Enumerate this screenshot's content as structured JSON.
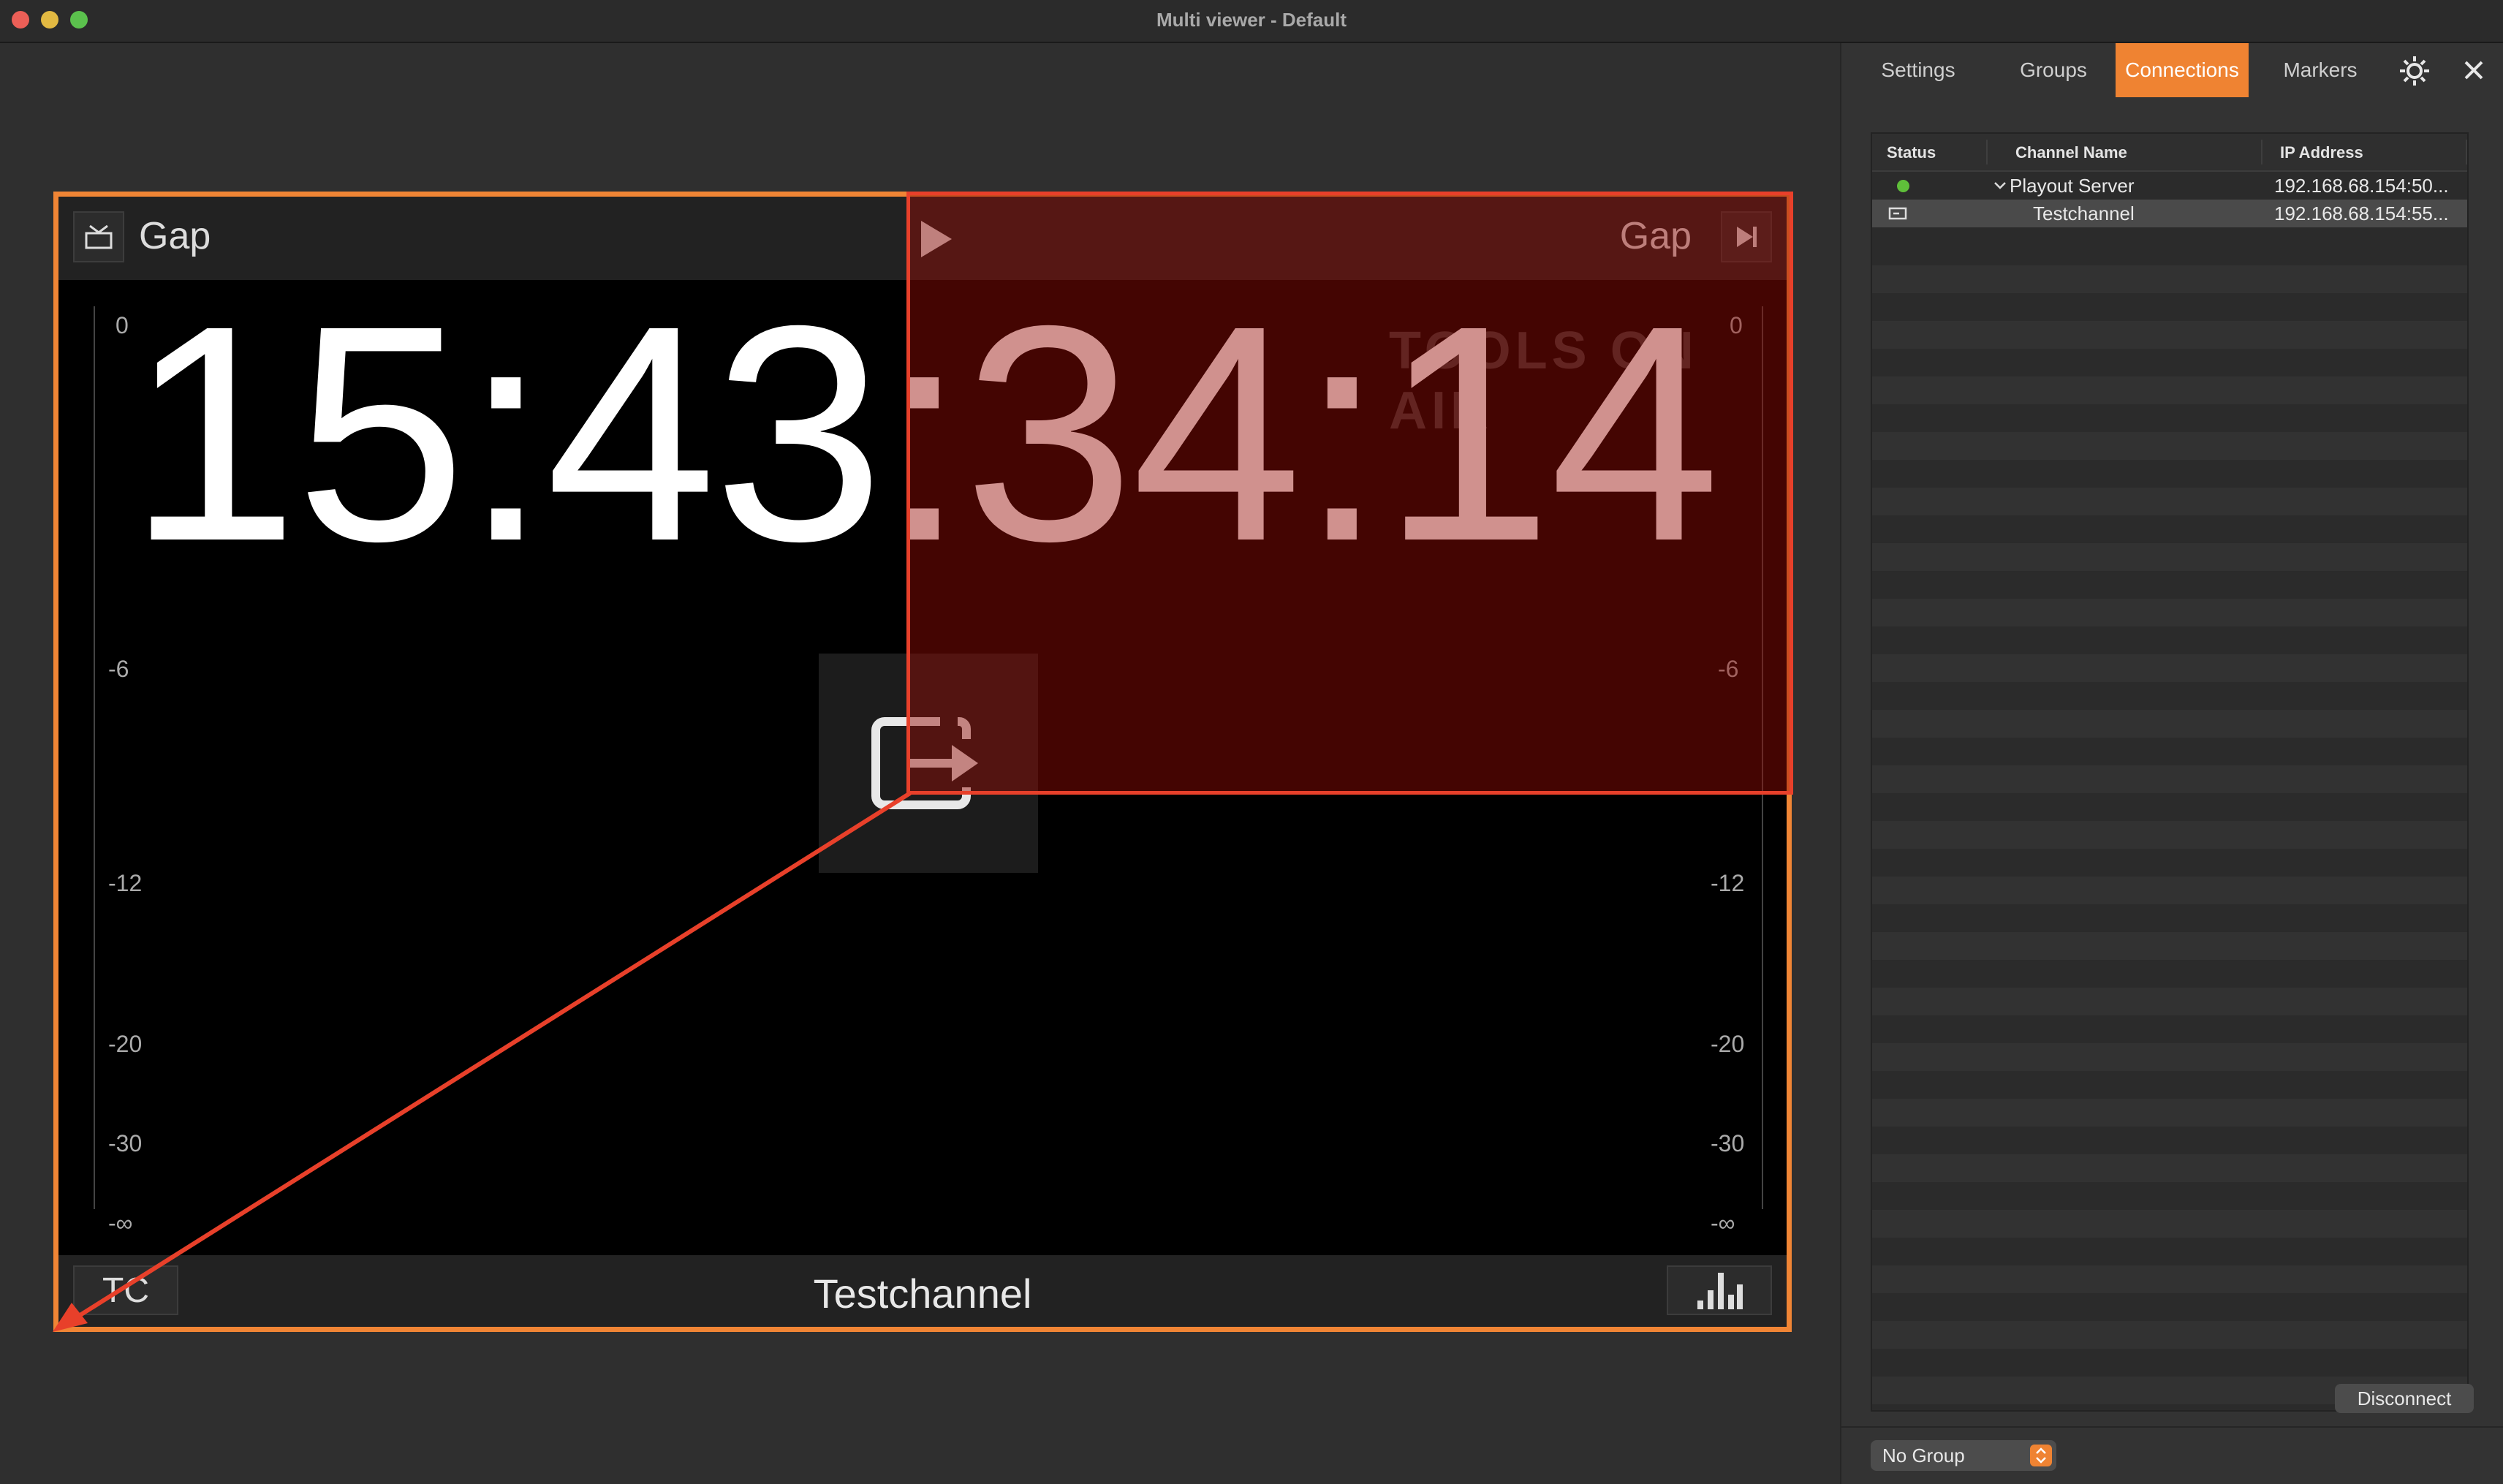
{
  "window": {
    "title": "Multi viewer - Default"
  },
  "viewer": {
    "left_event": "Gap",
    "right_event": "Gap",
    "clock": "15:43:34:14",
    "watermark": "TOOLS ON AIR",
    "channel_name": "Testchannel",
    "tc_button": "TC",
    "scale_labels": [
      "0",
      "-6",
      "-12",
      "-20",
      "-30",
      "-∞"
    ]
  },
  "sidebar": {
    "tabs": [
      {
        "label": "Settings",
        "active": false
      },
      {
        "label": "Groups",
        "active": false
      },
      {
        "label": "Connections",
        "active": true
      },
      {
        "label": "Markers",
        "active": false
      }
    ],
    "table": {
      "headers": [
        "Status",
        "Channel Name",
        "IP Address"
      ],
      "rows": [
        {
          "status": "online",
          "name": "Playout Server",
          "ip": "192.168.68.154:50...",
          "expanded": true
        },
        {
          "status": "channel",
          "name": "Testchannel",
          "ip": "192.168.68.154:55...",
          "selected": true
        }
      ]
    },
    "disconnect_label": "Disconnect",
    "group_select": "No Group"
  },
  "colors": {
    "accent": "#ef8332",
    "highlight_red": "#e8402a",
    "status_green": "#5fbf3a"
  }
}
